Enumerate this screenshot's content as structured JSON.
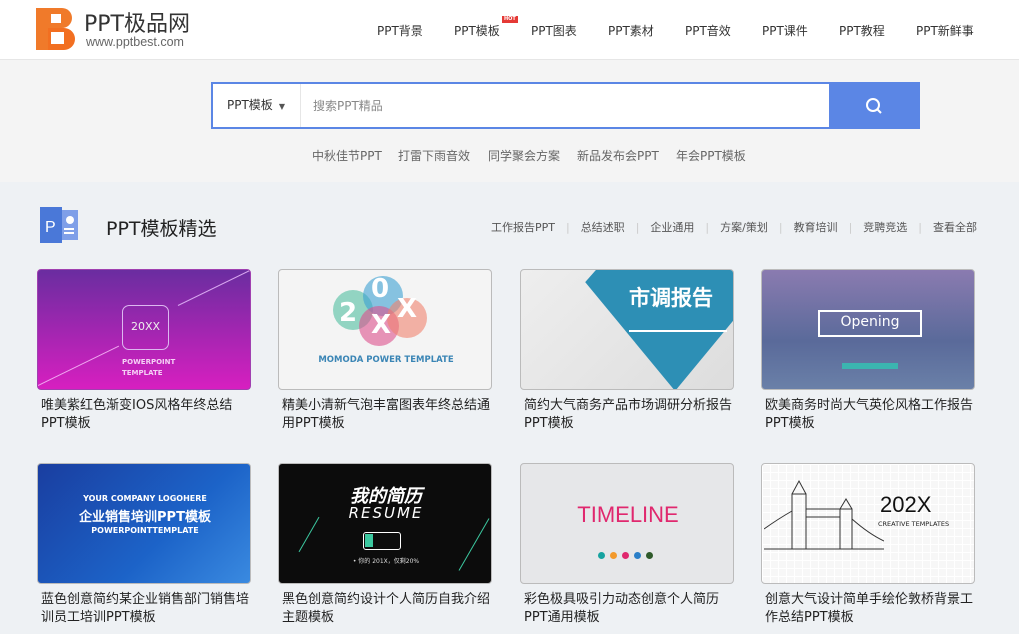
{
  "header": {
    "logo_name": "PPT极品网",
    "logo_url": "www.pptbest.com",
    "logo_letter": "B",
    "nav": [
      "PPT背景",
      "PPT模板",
      "PPT图表",
      "PPT素材",
      "PPT音效",
      "PPT课件",
      "PPT教程",
      "PPT新鲜事"
    ],
    "hot_badge": "HOT"
  },
  "search": {
    "category": "PPT模板",
    "placeholder": "搜索PPT精品",
    "value": "",
    "button_icon": "search-icon",
    "accent": "#5b86e5",
    "hot_tags": [
      "中秋佳节PPT",
      "打雷下雨音效",
      "同学聚会方案",
      "新品发布会PPT",
      "年会PPT模板"
    ]
  },
  "section": {
    "title": "PPT模板精选",
    "links": [
      "工作报告PPT",
      "总结述职",
      "企业通用",
      "方案/策划",
      "教育培训",
      "竞聘竞选",
      "查看全部"
    ]
  },
  "cards": [
    {
      "title": "唯美紫红色渐变IOS风格年终总结PPT模板",
      "thumb": {
        "l1": "20XX",
        "l2": "POWERPOINT",
        "l3": "TEMPLATE"
      }
    },
    {
      "title": "精美小清新气泡丰富图表年终总结通用PPT模板",
      "thumb": {
        "l1": "2",
        "l2": "0",
        "l3": "X",
        "l4": "X",
        "l5": "MOMODA POWER TEMPLATE"
      }
    },
    {
      "title": "简约大气商务产品市场调研分析报告PPT模板",
      "thumb": {
        "l1": "市调报告"
      }
    },
    {
      "title": "欧美商务时尚大气英伦风格工作报告PPT模板",
      "thumb": {
        "l1": "Opening"
      }
    },
    {
      "title": "蓝色创意简约某企业销售部门销售培训员工培训PPT模板",
      "thumb": {
        "l1": "YOUR COMPANY LOGOHERE",
        "l2": "企业销售培训PPT模板",
        "l3": "POWERPOINTTEMPLATE"
      }
    },
    {
      "title": "黑色创意简约设计个人简历自我介绍主题模板",
      "thumb": {
        "l1": "我的简历",
        "l2": "RESUME",
        "l3": "• 你的 201X，仅剩20%"
      }
    },
    {
      "title": "彩色极具吸引力动态创意个人简历PPT通用模板",
      "thumb": {
        "l1": "TIMELINE"
      }
    },
    {
      "title": "创意大气设计简单手绘伦敦桥背景工作总结PPT模板",
      "thumb": {
        "l1": "202X",
        "l2": "CREATIVE TEMPLATES"
      }
    }
  ]
}
